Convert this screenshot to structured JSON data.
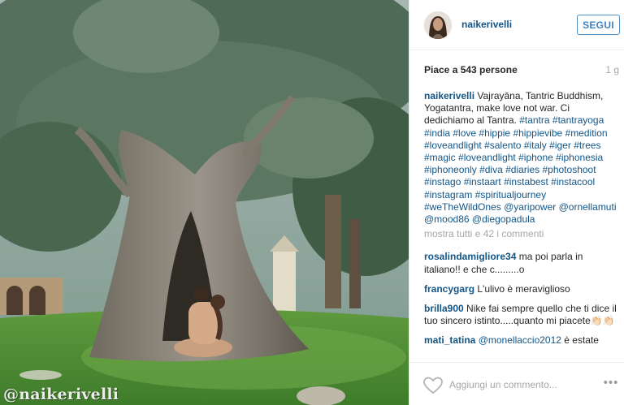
{
  "post": {
    "watermark": "@naikerivelli",
    "alt": "Coppia seduta sotto un grande ulivo secolare"
  },
  "header": {
    "username": "naikerivelli",
    "follow_label": "SEGUI"
  },
  "likes": {
    "text": "Piace a 543 persone",
    "time": "1 g"
  },
  "caption": {
    "user": "naikerivelli",
    "text": " Vajrayāna, Tantric Buddhism, Yogatantra, make love not war. Ci dedichiamo al Tantra. ",
    "tags": [
      "#tantra",
      "#tantrayoga",
      "#india",
      "#love",
      "#hippie",
      "#hippievibe",
      "#medition",
      "#loveandlight",
      "#salento",
      "#italy",
      "#iger",
      "#trees",
      "#magic",
      "#loveandlight",
      "#iphone",
      "#iphonesia",
      "#iphoneonly",
      "#diva",
      "#diaries",
      "#photoshoot",
      "#instago",
      "#instaart",
      "#instabest",
      "#instacool",
      "#instagram",
      "#spiritualjourney",
      "#weTheWildOnes",
      "@yaripower",
      "@ornellamuti",
      "@mood86",
      "@diegopadula"
    ]
  },
  "more_comments": "mostra tutti e 42 i commenti",
  "comments": [
    {
      "user": "rosalindamigliore34",
      "text": " ma poi parla in italiano!! e che c.........o"
    },
    {
      "user": "francygarg",
      "text": " L'ulivo è meraviglioso"
    },
    {
      "user": "brilla900",
      "text": " Nike fai sempre quello che ti dice il tuo sincero istinto.....quanto mi piacete👏🏻👏🏻"
    },
    {
      "user": "mati_tatina",
      "text": " ",
      "mention": "@monellaccio2012",
      "after": " è estate"
    }
  ],
  "footer": {
    "placeholder": "Aggiungi un commento...",
    "more_glyph": "•••"
  },
  "colors": {
    "link": "#125688",
    "muted": "#a5a7aa",
    "follow": "#3f81bd"
  }
}
